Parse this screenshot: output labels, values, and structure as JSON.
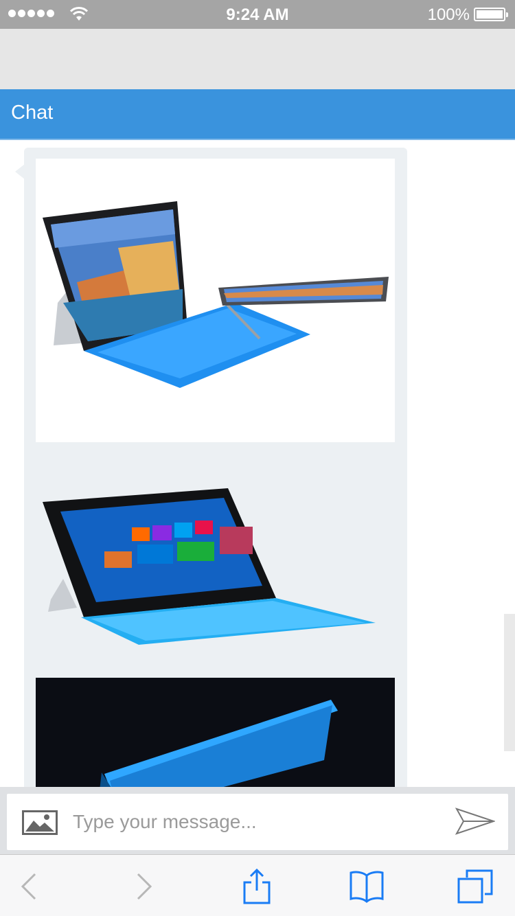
{
  "status_bar": {
    "time": "9:24 AM",
    "battery_percent": "100%",
    "signal_bars": 5,
    "battery_level": 1.0
  },
  "header": {
    "title": "Chat"
  },
  "chat": {
    "images": [
      {
        "icon": "surface-tablet-photo-1"
      },
      {
        "icon": "surface-tablet-photo-2"
      },
      {
        "icon": "surface-tablet-photo-3"
      }
    ]
  },
  "composer": {
    "placeholder": "Type your message...",
    "attach_icon": "image-icon",
    "send_icon": "paper-plane-icon"
  },
  "toolbar": {
    "items": [
      "back-icon",
      "forward-icon",
      "share-icon",
      "bookmarks-icon",
      "tabs-icon"
    ]
  },
  "colors": {
    "accent": "#3a93dd",
    "bubble": "#ecf0f3",
    "toolbar_blue": "#1a7cf5",
    "keyboard_blue": "#1e90f0"
  }
}
